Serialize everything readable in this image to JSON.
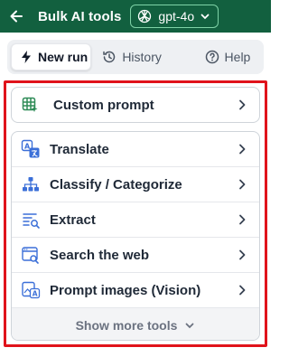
{
  "header": {
    "title": "Bulk AI tools",
    "model": "gpt-4o",
    "bg_color": "#12603f"
  },
  "tabs": [
    {
      "label": "New run",
      "icon": "bolt-icon",
      "active": true
    },
    {
      "label": "History",
      "icon": "history-icon",
      "active": false
    },
    {
      "label": "Help",
      "icon": "help-circle-icon",
      "active": false
    }
  ],
  "custom_prompt": {
    "label": "Custom prompt",
    "icon": "globe-sparkle-icon"
  },
  "tools": [
    {
      "label": "Translate",
      "icon": "translate-icon"
    },
    {
      "label": "Classify / Categorize",
      "icon": "hierarchy-icon"
    },
    {
      "label": "Extract",
      "icon": "extract-icon"
    },
    {
      "label": "Search the web",
      "icon": "browser-search-icon"
    },
    {
      "label": "Prompt images (Vision)",
      "icon": "image-vision-icon"
    }
  ],
  "show_more": {
    "label": "Show more tools"
  },
  "colors": {
    "accent": "#12603f",
    "icon_blue": "#3b6fd8",
    "icon_green": "#2e8b57",
    "highlight": "#e0131b"
  }
}
